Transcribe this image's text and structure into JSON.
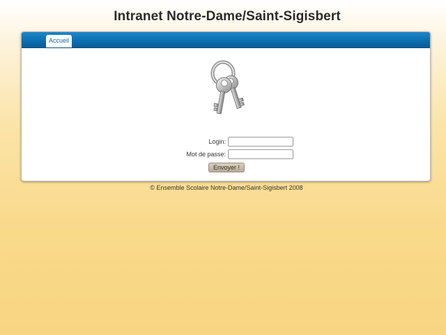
{
  "header": {
    "title": "Intranet Notre-Dame/Saint-Sigisbert"
  },
  "tabs": [
    {
      "label": "Accueil",
      "active": true
    }
  ],
  "login_form": {
    "login_label": "Login:",
    "login_value": "",
    "password_label": "Mot de passe:",
    "password_value": "",
    "submit_label": "Envoyer !"
  },
  "icons": {
    "login_image": "keys-icon"
  },
  "footer": {
    "copyright": "© Ensemble Scolaire Notre-Dame/Saint-Sigisbert 2008"
  },
  "colors": {
    "tabbar_blue": "#0b6fb0",
    "background_yellow": "#f8d581",
    "button_tan": "#c8bdab"
  }
}
